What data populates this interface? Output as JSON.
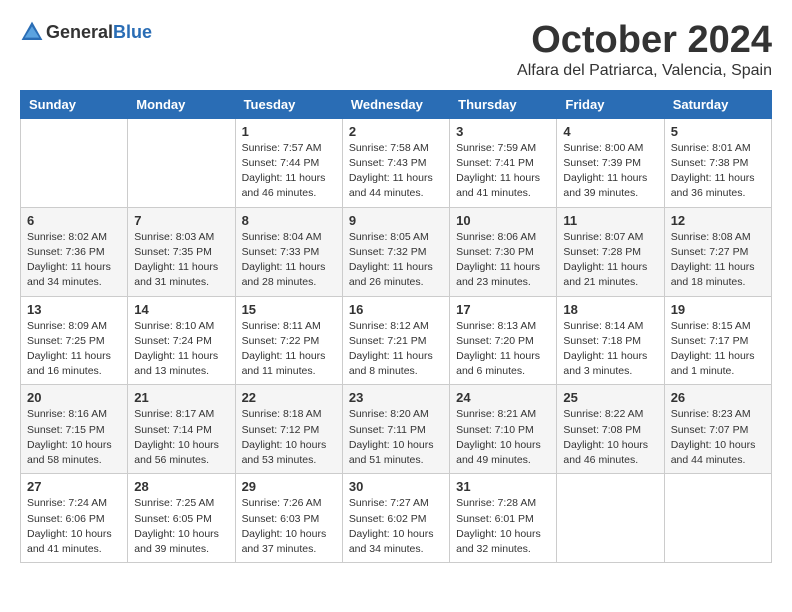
{
  "header": {
    "logo_general": "General",
    "logo_blue": "Blue",
    "month": "October 2024",
    "location": "Alfara del Patriarca, Valencia, Spain"
  },
  "days_of_week": [
    "Sunday",
    "Monday",
    "Tuesday",
    "Wednesday",
    "Thursday",
    "Friday",
    "Saturday"
  ],
  "weeks": [
    [
      {
        "day": "",
        "sunrise": "",
        "sunset": "",
        "daylight": ""
      },
      {
        "day": "",
        "sunrise": "",
        "sunset": "",
        "daylight": ""
      },
      {
        "day": "1",
        "sunrise": "Sunrise: 7:57 AM",
        "sunset": "Sunset: 7:44 PM",
        "daylight": "Daylight: 11 hours and 46 minutes."
      },
      {
        "day": "2",
        "sunrise": "Sunrise: 7:58 AM",
        "sunset": "Sunset: 7:43 PM",
        "daylight": "Daylight: 11 hours and 44 minutes."
      },
      {
        "day": "3",
        "sunrise": "Sunrise: 7:59 AM",
        "sunset": "Sunset: 7:41 PM",
        "daylight": "Daylight: 11 hours and 41 minutes."
      },
      {
        "day": "4",
        "sunrise": "Sunrise: 8:00 AM",
        "sunset": "Sunset: 7:39 PM",
        "daylight": "Daylight: 11 hours and 39 minutes."
      },
      {
        "day": "5",
        "sunrise": "Sunrise: 8:01 AM",
        "sunset": "Sunset: 7:38 PM",
        "daylight": "Daylight: 11 hours and 36 minutes."
      }
    ],
    [
      {
        "day": "6",
        "sunrise": "Sunrise: 8:02 AM",
        "sunset": "Sunset: 7:36 PM",
        "daylight": "Daylight: 11 hours and 34 minutes."
      },
      {
        "day": "7",
        "sunrise": "Sunrise: 8:03 AM",
        "sunset": "Sunset: 7:35 PM",
        "daylight": "Daylight: 11 hours and 31 minutes."
      },
      {
        "day": "8",
        "sunrise": "Sunrise: 8:04 AM",
        "sunset": "Sunset: 7:33 PM",
        "daylight": "Daylight: 11 hours and 28 minutes."
      },
      {
        "day": "9",
        "sunrise": "Sunrise: 8:05 AM",
        "sunset": "Sunset: 7:32 PM",
        "daylight": "Daylight: 11 hours and 26 minutes."
      },
      {
        "day": "10",
        "sunrise": "Sunrise: 8:06 AM",
        "sunset": "Sunset: 7:30 PM",
        "daylight": "Daylight: 11 hours and 23 minutes."
      },
      {
        "day": "11",
        "sunrise": "Sunrise: 8:07 AM",
        "sunset": "Sunset: 7:28 PM",
        "daylight": "Daylight: 11 hours and 21 minutes."
      },
      {
        "day": "12",
        "sunrise": "Sunrise: 8:08 AM",
        "sunset": "Sunset: 7:27 PM",
        "daylight": "Daylight: 11 hours and 18 minutes."
      }
    ],
    [
      {
        "day": "13",
        "sunrise": "Sunrise: 8:09 AM",
        "sunset": "Sunset: 7:25 PM",
        "daylight": "Daylight: 11 hours and 16 minutes."
      },
      {
        "day": "14",
        "sunrise": "Sunrise: 8:10 AM",
        "sunset": "Sunset: 7:24 PM",
        "daylight": "Daylight: 11 hours and 13 minutes."
      },
      {
        "day": "15",
        "sunrise": "Sunrise: 8:11 AM",
        "sunset": "Sunset: 7:22 PM",
        "daylight": "Daylight: 11 hours and 11 minutes."
      },
      {
        "day": "16",
        "sunrise": "Sunrise: 8:12 AM",
        "sunset": "Sunset: 7:21 PM",
        "daylight": "Daylight: 11 hours and 8 minutes."
      },
      {
        "day": "17",
        "sunrise": "Sunrise: 8:13 AM",
        "sunset": "Sunset: 7:20 PM",
        "daylight": "Daylight: 11 hours and 6 minutes."
      },
      {
        "day": "18",
        "sunrise": "Sunrise: 8:14 AM",
        "sunset": "Sunset: 7:18 PM",
        "daylight": "Daylight: 11 hours and 3 minutes."
      },
      {
        "day": "19",
        "sunrise": "Sunrise: 8:15 AM",
        "sunset": "Sunset: 7:17 PM",
        "daylight": "Daylight: 11 hours and 1 minute."
      }
    ],
    [
      {
        "day": "20",
        "sunrise": "Sunrise: 8:16 AM",
        "sunset": "Sunset: 7:15 PM",
        "daylight": "Daylight: 10 hours and 58 minutes."
      },
      {
        "day": "21",
        "sunrise": "Sunrise: 8:17 AM",
        "sunset": "Sunset: 7:14 PM",
        "daylight": "Daylight: 10 hours and 56 minutes."
      },
      {
        "day": "22",
        "sunrise": "Sunrise: 8:18 AM",
        "sunset": "Sunset: 7:12 PM",
        "daylight": "Daylight: 10 hours and 53 minutes."
      },
      {
        "day": "23",
        "sunrise": "Sunrise: 8:20 AM",
        "sunset": "Sunset: 7:11 PM",
        "daylight": "Daylight: 10 hours and 51 minutes."
      },
      {
        "day": "24",
        "sunrise": "Sunrise: 8:21 AM",
        "sunset": "Sunset: 7:10 PM",
        "daylight": "Daylight: 10 hours and 49 minutes."
      },
      {
        "day": "25",
        "sunrise": "Sunrise: 8:22 AM",
        "sunset": "Sunset: 7:08 PM",
        "daylight": "Daylight: 10 hours and 46 minutes."
      },
      {
        "day": "26",
        "sunrise": "Sunrise: 8:23 AM",
        "sunset": "Sunset: 7:07 PM",
        "daylight": "Daylight: 10 hours and 44 minutes."
      }
    ],
    [
      {
        "day": "27",
        "sunrise": "Sunrise: 7:24 AM",
        "sunset": "Sunset: 6:06 PM",
        "daylight": "Daylight: 10 hours and 41 minutes."
      },
      {
        "day": "28",
        "sunrise": "Sunrise: 7:25 AM",
        "sunset": "Sunset: 6:05 PM",
        "daylight": "Daylight: 10 hours and 39 minutes."
      },
      {
        "day": "29",
        "sunrise": "Sunrise: 7:26 AM",
        "sunset": "Sunset: 6:03 PM",
        "daylight": "Daylight: 10 hours and 37 minutes."
      },
      {
        "day": "30",
        "sunrise": "Sunrise: 7:27 AM",
        "sunset": "Sunset: 6:02 PM",
        "daylight": "Daylight: 10 hours and 34 minutes."
      },
      {
        "day": "31",
        "sunrise": "Sunrise: 7:28 AM",
        "sunset": "Sunset: 6:01 PM",
        "daylight": "Daylight: 10 hours and 32 minutes."
      },
      {
        "day": "",
        "sunrise": "",
        "sunset": "",
        "daylight": ""
      },
      {
        "day": "",
        "sunrise": "",
        "sunset": "",
        "daylight": ""
      }
    ]
  ]
}
